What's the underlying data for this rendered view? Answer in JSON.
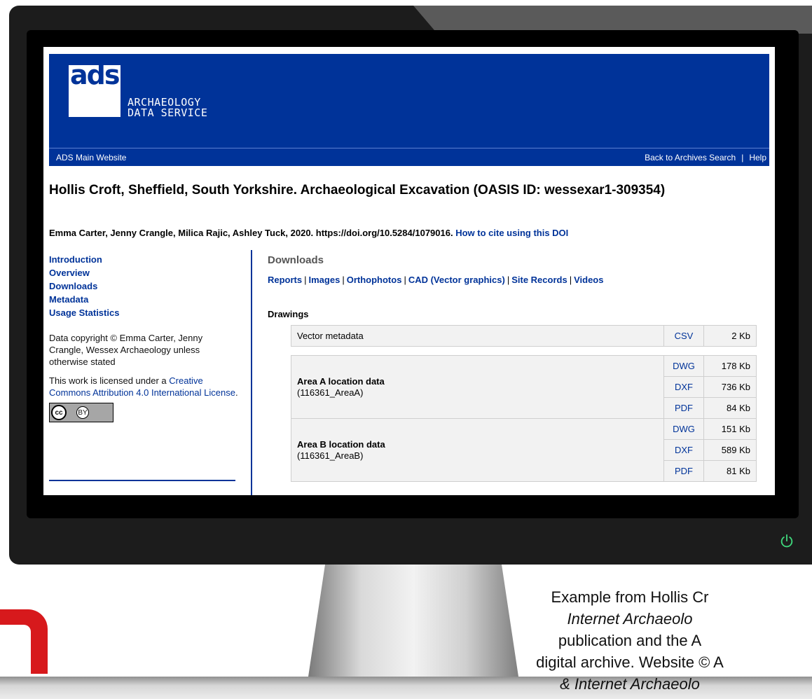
{
  "site": {
    "logo_abbr": "ads",
    "logo_line1": "ARCHAEOLOGY",
    "logo_line2": "DATA SERVICE",
    "nav_left": "ADS Main Website",
    "nav_right": [
      "Back to Archives Search",
      "Help"
    ],
    "nav_separator": "|"
  },
  "page": {
    "title": "Hollis Croft, Sheffield, South Yorkshire. Archaeological Excavation (OASIS ID: wessexar1-309354)",
    "authors_text": "Emma Carter, Jenny Crangle, Milica Rajic, Ashley Tuck, 2020. https://doi.org/10.5284/1079016.",
    "cite_link": "How to cite using this DOI"
  },
  "sidebar": {
    "links": [
      "Introduction",
      "Overview",
      "Downloads",
      "Metadata",
      "Usage Statistics"
    ],
    "copyright": "Data copyright © Emma Carter, Jenny Crangle, Wessex Archaeology unless otherwise stated",
    "license_prefix": "This work is licensed under a",
    "license_link": "Creative Commons Attribution 4.0 International License",
    "license_suffix": ".",
    "badge_cc": "cc",
    "badge_by": "BY"
  },
  "downloads": {
    "heading": "Downloads",
    "tabs": [
      "Reports",
      "Images",
      "Orthophotos",
      "CAD (Vector graphics)",
      "Site Records",
      "Videos"
    ],
    "section": "Drawings",
    "metadata_row": {
      "label": "Vector metadata",
      "format": "CSV",
      "size": "2 Kb"
    },
    "groups": [
      {
        "name": "Area A location data",
        "code": "(116361_AreaA)",
        "files": [
          {
            "format": "DWG",
            "size": "178 Kb"
          },
          {
            "format": "DXF",
            "size": "736 Kb"
          },
          {
            "format": "PDF",
            "size": "84 Kb"
          }
        ]
      },
      {
        "name": "Area B location data",
        "code": "(116361_AreaB)",
        "files": [
          {
            "format": "DWG",
            "size": "151 Kb"
          },
          {
            "format": "DXF",
            "size": "589 Kb"
          },
          {
            "format": "PDF",
            "size": "81 Kb"
          }
        ]
      }
    ]
  },
  "caption": {
    "line1": "Example from Hollis Cr",
    "line2": "Internet Archaeolo",
    "line3": "publication and the A",
    "line4": "digital archive. Website © A",
    "line5": "& Internet Archaeolo"
  },
  "colors": {
    "ads_blue": "#003399",
    "power_green": "#3fd87c",
    "brand_red": "#d7191c"
  },
  "icons": [
    "power-icon",
    "creative-commons-icon",
    "attribution-icon"
  ]
}
